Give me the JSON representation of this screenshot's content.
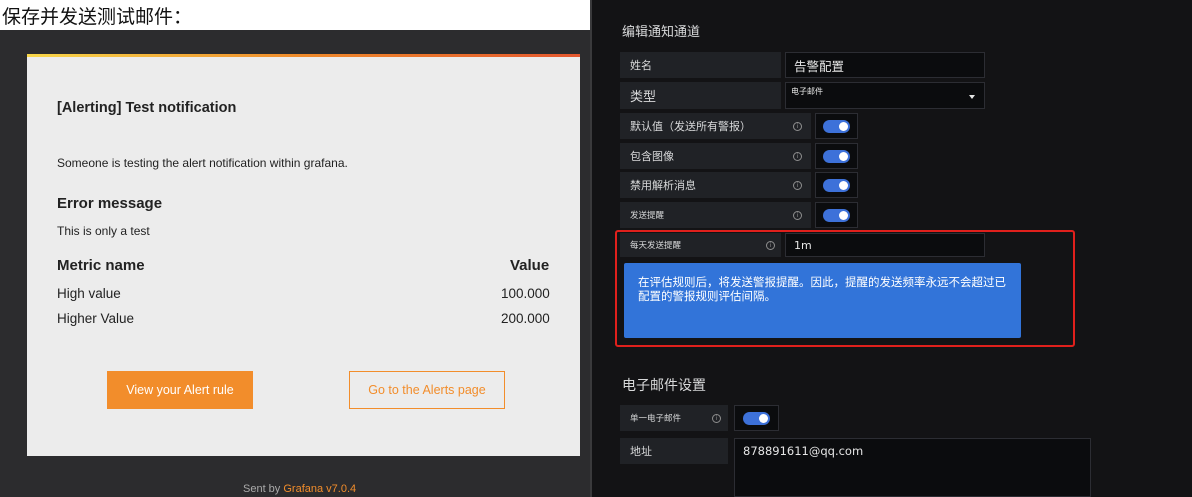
{
  "caption": "保存并发送测试邮件：",
  "email": {
    "title": "[Alerting] Test notification",
    "description": "Someone is testing the alert notification within grafana.",
    "error_heading": "Error message",
    "error_text": "This is only a test",
    "metric_header": "Metric name",
    "value_header": "Value",
    "metrics": [
      {
        "name": "High value",
        "value": "100.000"
      },
      {
        "name": "Higher Value",
        "value": "200.000"
      }
    ],
    "primary_button": "View your Alert rule",
    "secondary_button": "Go to the Alerts page",
    "footer_prefix": "Sent by",
    "footer_link": "Grafana v7.0.4",
    "accent_color": "#f28d2b"
  },
  "settings": {
    "heading": "编辑通知通道",
    "name_label": "姓名",
    "name_value": "告警配置",
    "type_label": "类型",
    "type_value": "电子邮件",
    "default_label": "默认值（发送所有警报）",
    "include_image_label": "包含图像",
    "disable_resolve_label": "禁用解析消息",
    "send_reminders_label": "发送提醒",
    "daily_reminder_label": "每天发送提醒",
    "daily_reminder_value": "1m",
    "tooltip_line1": "在评估规则后，将发送警报提醒。因此，提醒的发送频率永远不会超过已",
    "tooltip_line2": "配置的警报规则评估间隔。",
    "email_section": "电子邮件设置",
    "single_email_label": "单一电子邮件",
    "address_label": "地址",
    "address_value": "878891611@qq.com",
    "toggle_color": "#3d71d9",
    "tooltip_color": "#3274d9",
    "highlight_color": "#e0201c"
  }
}
